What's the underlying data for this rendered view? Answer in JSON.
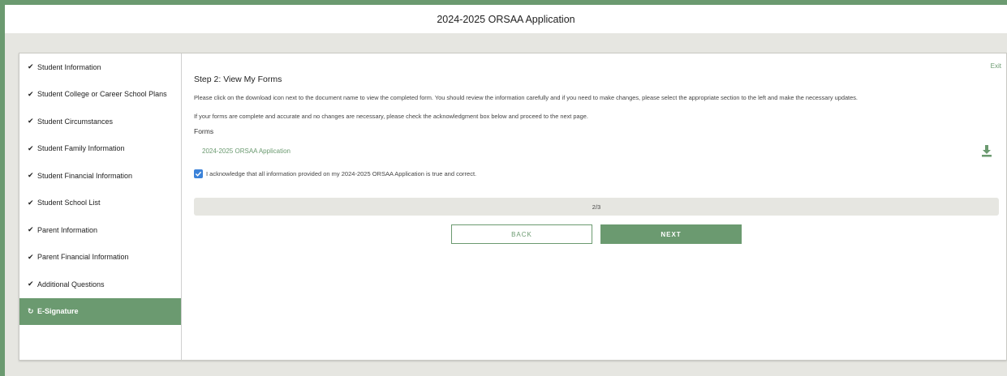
{
  "header": {
    "title": "2024-2025 ORSAA Application"
  },
  "sidebar": {
    "items": [
      {
        "label": "Student Information",
        "icon": "✔"
      },
      {
        "label": "Student College or Career School Plans",
        "icon": "✔"
      },
      {
        "label": "Student Circumstances",
        "icon": "✔"
      },
      {
        "label": "Student Family Information",
        "icon": "✔"
      },
      {
        "label": "Student Financial Information",
        "icon": "✔"
      },
      {
        "label": "Student School List",
        "icon": "✔"
      },
      {
        "label": "Parent Information",
        "icon": "✔"
      },
      {
        "label": "Parent Financial Information",
        "icon": "✔"
      },
      {
        "label": "Additional Questions",
        "icon": "✔"
      },
      {
        "label": "E-Signature",
        "icon": "↻"
      }
    ]
  },
  "main": {
    "exit_label": "Exit",
    "step_title": "Step 2: View My Forms",
    "instructions_1": "Please click on the download icon next to the document name to view the completed form. You should review the information carefully and if you need to make changes, please select the appropriate section to the left and make the necessary updates.",
    "instructions_2": "If your forms are complete and accurate and no changes are necessary, please check the acknowledgment box below and proceed to the next page.",
    "forms_label": "Forms",
    "form_name": "2024-2025 ORSAA Application",
    "download_icon": "download-icon",
    "acknowledge_text": "I acknowledge that all information provided on my 2024-2025 ORSAA Application is true and correct.",
    "acknowledge_checked": true,
    "progress_text": "2/3",
    "back_label": "BACK",
    "next_label": "NEXT"
  },
  "colors": {
    "brand_green": "#6b9a70",
    "checkbox_blue": "#3b82d9",
    "background": "#e6e6e1"
  }
}
